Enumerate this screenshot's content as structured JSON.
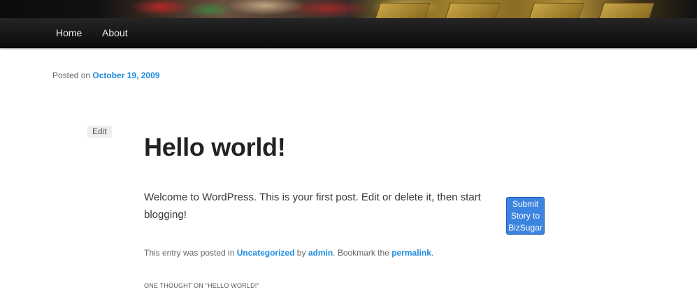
{
  "nav": {
    "items": [
      {
        "label": "Home"
      },
      {
        "label": "About"
      }
    ]
  },
  "post": {
    "posted_on_prefix": "Posted on",
    "date": "October 19, 2009",
    "edit_label": "Edit",
    "title": "Hello world!",
    "content": "Welcome to WordPress. This is your first post. Edit or delete it, then start blogging!",
    "share_button": {
      "line1": "Submit",
      "line2": "Story to",
      "line3": "BizSugar"
    },
    "meta": {
      "prefix": "This entry was posted in",
      "category": "Uncategorized",
      "by": "by",
      "author": "admin",
      "bookmark": ". Bookmark the",
      "permalink": "permalink",
      "end": "."
    },
    "comments_title": "ONE THOUGHT ON \"HELLO WORLD!\""
  },
  "colors": {
    "link": "#1b8be0",
    "navbar": "#1a1a1a",
    "share_button": "#3d83e0"
  }
}
